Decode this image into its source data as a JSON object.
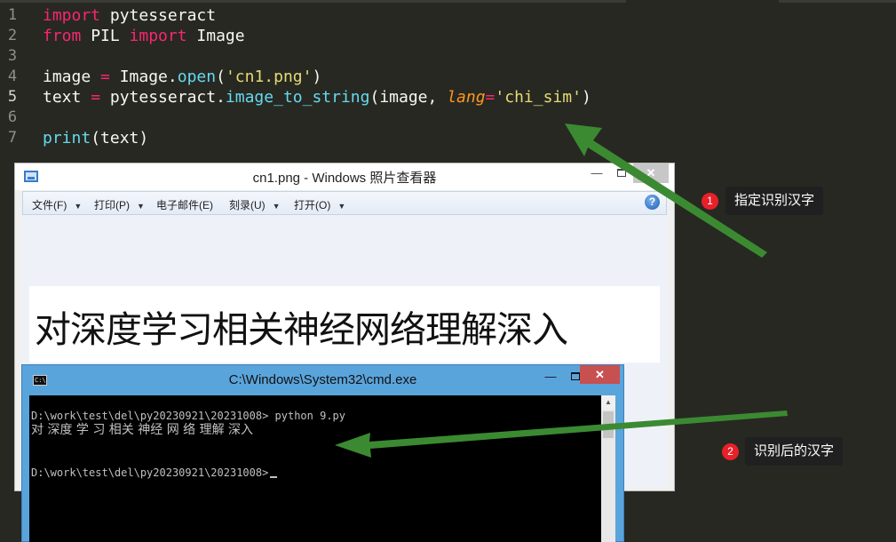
{
  "editor": {
    "lines": [
      {
        "num": "1",
        "tokens": [
          {
            "t": "import",
            "c": "kw"
          },
          {
            "t": " pytesseract",
            "c": ""
          }
        ]
      },
      {
        "num": "2",
        "tokens": [
          {
            "t": "from",
            "c": "kw"
          },
          {
            "t": " PIL ",
            "c": ""
          },
          {
            "t": "import",
            "c": "kw"
          },
          {
            "t": " Image",
            "c": ""
          }
        ]
      },
      {
        "num": "3",
        "tokens": []
      },
      {
        "num": "4",
        "tokens": [
          {
            "t": "image ",
            "c": ""
          },
          {
            "t": "=",
            "c": "op"
          },
          {
            "t": " Image.",
            "c": ""
          },
          {
            "t": "open",
            "c": "fn"
          },
          {
            "t": "(",
            "c": ""
          },
          {
            "t": "'cn1.png'",
            "c": "str"
          },
          {
            "t": ")",
            "c": ""
          }
        ]
      },
      {
        "num": "5",
        "tokens": [
          {
            "t": "text ",
            "c": ""
          },
          {
            "t": "=",
            "c": "op"
          },
          {
            "t": " pytesseract.",
            "c": ""
          },
          {
            "t": "image_to_string",
            "c": "fn"
          },
          {
            "t": "(image, ",
            "c": ""
          },
          {
            "t": "lang",
            "c": "arg"
          },
          {
            "t": "=",
            "c": "op"
          },
          {
            "t": "'chi_sim'",
            "c": "str"
          },
          {
            "t": ")",
            "c": ""
          }
        ]
      },
      {
        "num": "6",
        "tokens": []
      },
      {
        "num": "7",
        "tokens": [
          {
            "t": "print",
            "c": "fn"
          },
          {
            "t": "(text)",
            "c": ""
          }
        ]
      }
    ],
    "current_line": "5"
  },
  "viewer": {
    "title": "cn1.png - Windows 照片查看器",
    "menu": [
      {
        "label": "文件(F)",
        "has_arrow": true
      },
      {
        "label": "打印(P)",
        "has_arrow": true
      },
      {
        "label": "电子邮件(E)",
        "has_arrow": false
      },
      {
        "label": "刻录(U)",
        "has_arrow": true
      },
      {
        "label": "打开(O)",
        "has_arrow": true
      }
    ],
    "image_text": "对深度学习相关神经网络理解深入",
    "help_glyph": "?"
  },
  "cmd": {
    "title": "C:\\Windows\\System32\\cmd.exe",
    "icon_text": "C:\\",
    "line1": "D:\\work\\test\\del\\py20230921\\20231008> python 9.py",
    "output": "对 深度 学 习 相关 神经 网 络 理解 深入",
    "line3": "D:\\work\\test\\del\\py20230921\\20231008>"
  },
  "annotations": [
    {
      "badge": "1",
      "text": "指定识别汉字"
    },
    {
      "badge": "2",
      "text": "识别后的汉字"
    }
  ],
  "colors": {
    "editor_bg": "#272822",
    "keyword": "#f92672",
    "function": "#66d9ef",
    "string": "#e6db74",
    "argument": "#fd971f",
    "arrow": "#3b8a32",
    "badge": "#e8202a"
  }
}
